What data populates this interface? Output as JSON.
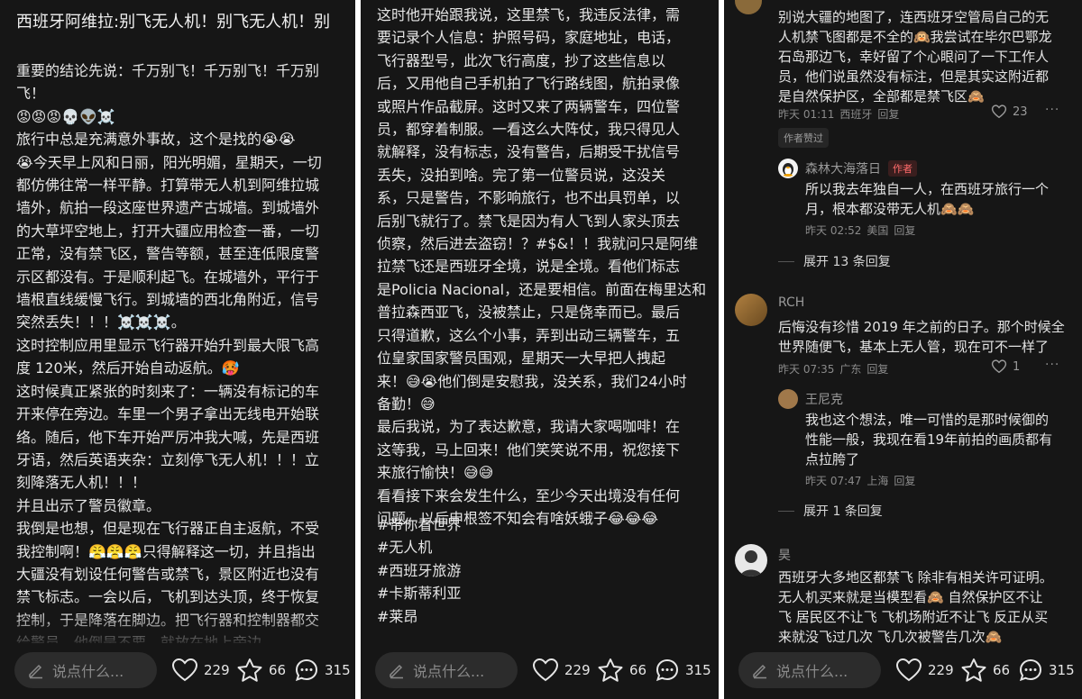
{
  "left": {
    "title": "西班牙阿维拉:别飞无人机！别飞无人机！别",
    "lines": [
      "重要的结论先说：千万别飞！千万别飞！千万别",
      "飞！",
      "😡😡😡💀👽☠️",
      "旅行中总是充满意外事故，这个是找的😭😭",
      "😭今天早上风和日丽，阳光明媚，星期天，一切",
      "都仿佛往常一样平静。打算带无人机到阿维拉城",
      "墙外，航拍一段这座世界遗产古城墙。到城墙外",
      "的大草坪空地上，打开大疆应用检查一番，一切",
      "正常，没有禁飞区，警告等额，甚至连低限度警",
      "示区都没有。于是顺利起飞。在城墙外，平行于",
      "墙根直线缓慢飞行。到城墙的西北角附近，信号",
      "突然丢失！！！☠️☠️☠️。",
      "这时控制应用里显示飞行器开始升到最大限飞高",
      "度 120米，然后开始自动返航。🥵",
      "这时候真正紧张的时刻来了：一辆没有标记的车",
      "开来停在旁边。车里一个男子拿出无线电开始联",
      "络。随后，他下车开始严厉冲我大喊，先是西班",
      "牙语，然后英语夹杂：立刻停飞无人机！！！立",
      "刻降落无人机！！！",
      "并且出示了警员徽章。",
      "我倒是也想，但是现在飞行器正自主返航，不受",
      "我控制啊！😤😤😤只得解释这一切，并且指出",
      "大疆没有划设任何警告或禁飞，景区附近也没有",
      "禁飞标志。一会以后，飞机到达头顶，终于恢复",
      "控制，于是降落在脚边。把飞行器和控制器都交",
      "给警员。他倒是不要，就放在地上旁边。",
      "这时他开始跟我说，这里禁飞，我违反法律，需"
    ]
  },
  "middle": {
    "lines": [
      "这时他开始跟我说，这里禁飞，我违反法律，需",
      "要记录个人信息：护照号码，家庭地址，电话，",
      "飞行器型号，此次飞行高度，抄了这些信息以",
      "后，又用他自己手机拍了飞行路线图，航拍录像",
      "或照片作品截屏。这时又来了两辆警车，四位警",
      "员，都穿着制服。一看这么大阵仗，我只得见人",
      "就解释，没有标志，没有警告，后期受干扰信号",
      "丢失，没拍到啥。完了第一位警员说，这没关",
      "系，只是警告，不影响旅行，也不出具罚单，以",
      "后别飞就行了。禁飞是因为有人飞到人家头顶去",
      "侦察，然后进去盗窃！？#$&！！我就问只是阿维",
      "拉禁飞还是西班牙全境，说是全境。看他们标志",
      "是Policia Nacional，还是要相信。前面在梅里达和",
      "普拉森西亚飞，没被禁止，只是侥幸而已。最后",
      "只得道歉，这么个小事，弄到出动三辆警车，五",
      "位皇家国家警员围观，星期天一大早把人拽起",
      "来！😅😭他们倒是安慰我，没关系，我们24小时",
      "备勤！😅",
      "最后我说，为了表达歉意，我请大家喝咖啡！在",
      "这等我，马上回来！他们笑笑说不用，祝您接下",
      "来旅行愉快！😅😅",
      "看看接下来会发生什么，至少今天出境没有任何",
      "问题。以后申根签不知会有啥妖蛾子😂😂😂"
    ],
    "tags": [
      "#带你看世界",
      "#无人机",
      "#西班牙旅游",
      "#卡斯蒂利亚",
      "#莱昂"
    ]
  },
  "comments": {
    "c1": {
      "lines": [
        "别说大疆的地图了，连西班牙空管局自己的无",
        "人机禁飞图都是不全的🙉我尝试在毕尔巴鄂龙",
        "石岛那边飞，幸好留了个心眼问了一下工作人",
        "员，他们说虽然没有标注，但是其实这附近都",
        "是自然保护区，全部都是禁飞区🙈"
      ],
      "time": "昨天 01:11",
      "location": "西班牙",
      "reply": "回复",
      "likes": "23",
      "badge": "作者赞过"
    },
    "r1": {
      "name": "森林大海落日",
      "author_tag": "作者",
      "lines": [
        "所以我去年独自一人，在西班牙旅行一个",
        "月，根本都没带无人机🙈🙈"
      ],
      "time": "昨天 02:52",
      "location": "美国",
      "reply": "回复"
    },
    "expand1": "展开 13 条回复",
    "c2": {
      "name": "RCH",
      "lines": [
        "后悔没有珍惜 2019 年之前的日子。那个时候全",
        "世界随便飞，基本上无人管，现在可不一样了"
      ],
      "time": "昨天 07:35",
      "location": "广东",
      "reply": "回复",
      "likes": "1"
    },
    "r2": {
      "name": "王尼克",
      "lines": [
        "我也这个想法，唯一可惜的是那时候御的",
        "性能一般，我现在看19年前拍的画质都有",
        "点拉胯了"
      ],
      "time": "昨天 07:47",
      "location": "上海",
      "reply": "回复"
    },
    "expand2": "展开 1 条回复",
    "c3": {
      "name": "昊",
      "lines": [
        "西班牙大多地区都禁飞 除非有相关许可证明。",
        "无人机买来就是当模型看🙈 自然保护区不让",
        "飞 居民区不让飞 飞机场附近不让飞 反正从买",
        "来就没飞过几次  飞几次被警告几次🙈"
      ]
    }
  },
  "bar": {
    "placeholder": "说点什么...",
    "likes": "229",
    "stars": "66",
    "comments": "315"
  }
}
